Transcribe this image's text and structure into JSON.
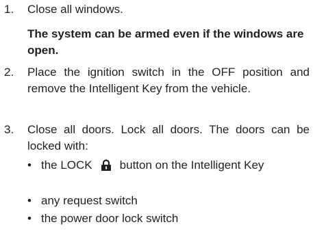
{
  "steps": [
    {
      "number": "1.",
      "text": "Close all windows."
    },
    {
      "number": "2.",
      "text": "Place the ignition switch in the OFF position and remove the Intelligent Key from the vehicle."
    },
    {
      "number": "3.",
      "text": "Close all doors. Lock all doors. The doors can be locked with:"
    }
  ],
  "note": "The system can be armed even if the windows are open.",
  "bullets": {
    "item1_before": "the LOCK",
    "item1_after": "button on the Intelligent Key",
    "item2": "any request switch",
    "item3": "the power door lock switch",
    "marker": "•"
  },
  "icons": {
    "lock": "lock-icon"
  }
}
